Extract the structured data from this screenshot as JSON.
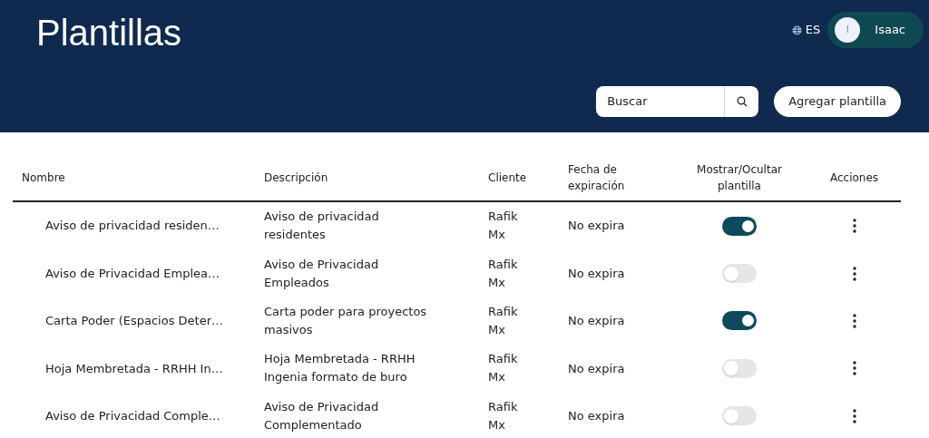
{
  "header": {
    "title": "Plantillas",
    "language": "ES",
    "user": {
      "initial": "I",
      "name": "Isaac"
    }
  },
  "search": {
    "placeholder": "Buscar"
  },
  "add_button": "Agregar plantilla",
  "table": {
    "columns": [
      "Nombre",
      "Descripción",
      "Cliente",
      "Fecha de expiración",
      "Mostrar/Ocultar plantilla",
      "Acciones"
    ],
    "rows": [
      {
        "name": "Aviso de privacidad residen…",
        "description": "Aviso de privacidad residentes",
        "client": "Rafik Mx",
        "expiration": "No expira",
        "visible": true
      },
      {
        "name": "Aviso de Privacidad Emplea…",
        "description": "Aviso de Privacidad Empleados",
        "client": "Rafik Mx",
        "expiration": "No expira",
        "visible": false
      },
      {
        "name": "Carta Poder (Espacios Deter…",
        "description": "Carta poder para proyectos masivos",
        "client": "Rafik Mx",
        "expiration": "No expira",
        "visible": true
      },
      {
        "name": "Hoja Membretada - RRHH In…",
        "description": "Hoja Membretada - RRHH Ingenia formato de buro",
        "client": "Rafik Mx",
        "expiration": "No expira",
        "visible": false
      },
      {
        "name": "Aviso de Privacidad Comple…",
        "description": "Aviso de Privacidad Complementado",
        "client": "Rafik Mx",
        "expiration": "No expira",
        "visible": false
      }
    ]
  }
}
